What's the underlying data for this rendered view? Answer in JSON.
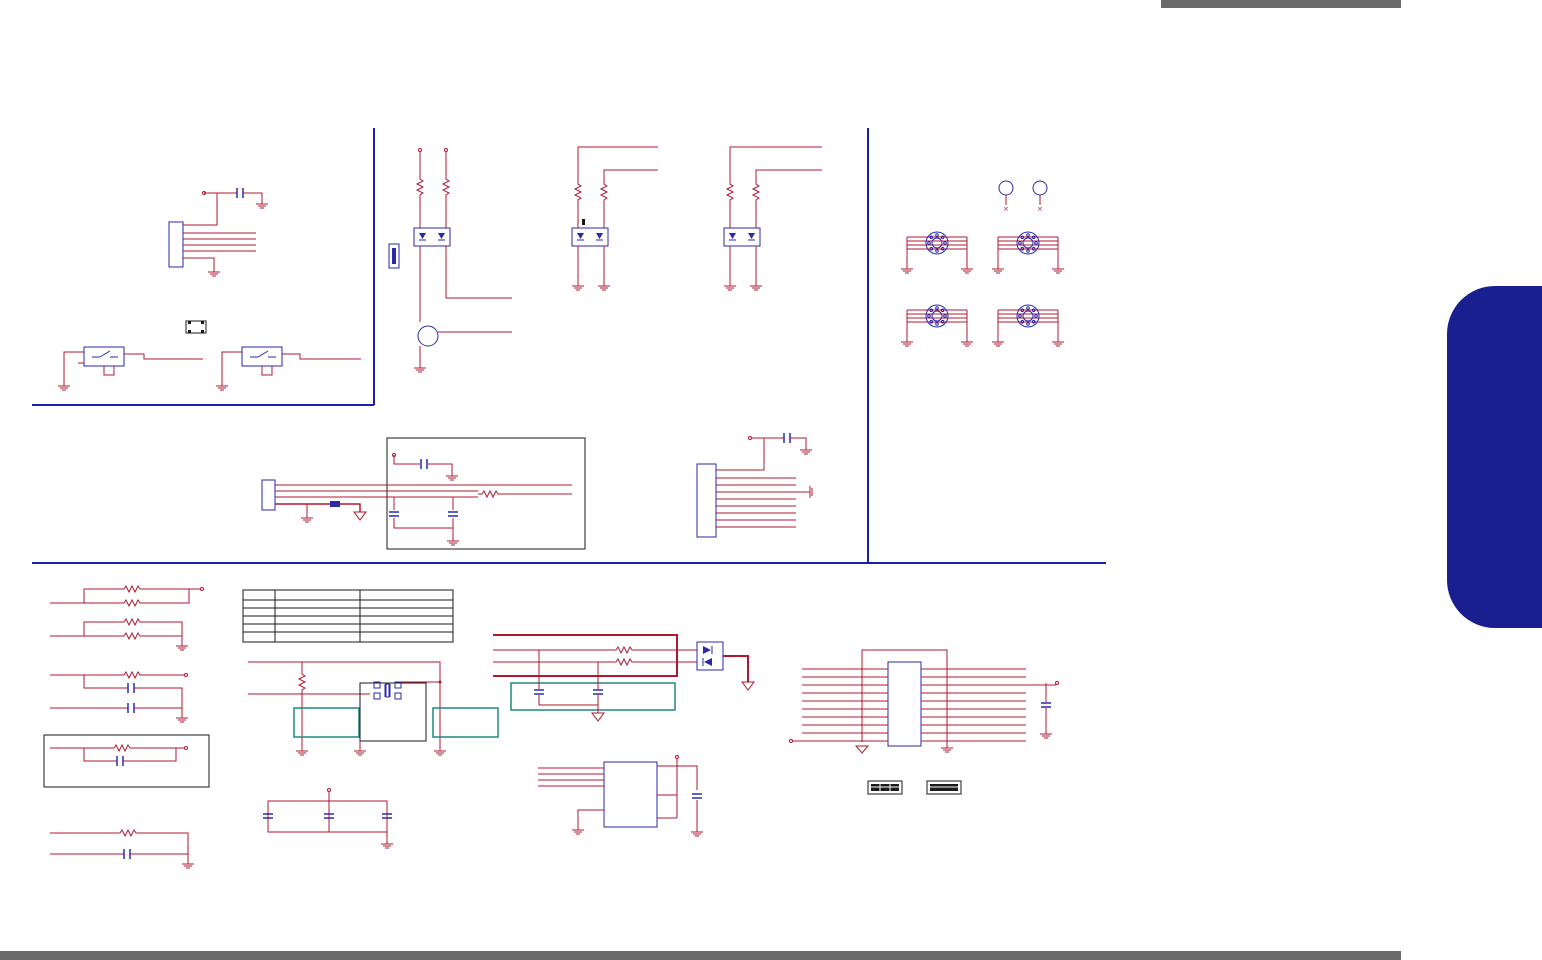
{
  "page": {
    "header_bar": "",
    "footer_bar": "",
    "side_tab": ""
  },
  "colors": {
    "wire": "#b01830",
    "part": "#2a2aaa",
    "frame": "#1a1fa8",
    "tab": "#1a1f8f",
    "bar": "#6b6b6b",
    "teal_box": "#1a8a80"
  },
  "icons": [
    "resistor-icon",
    "capacitor-icon",
    "ground-icon",
    "diode-icon",
    "transistor-icon",
    "switch-icon",
    "connector-icon",
    "mounting-hole-icon",
    "test-point-icon",
    "ic-chip-icon",
    "crystal-icon"
  ]
}
